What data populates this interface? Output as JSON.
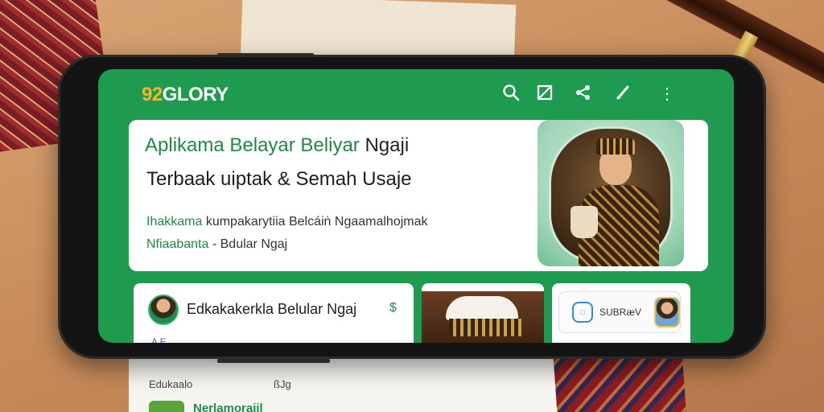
{
  "app": {
    "logo_number": "92",
    "logo_text": "GLORY"
  },
  "toolbar": {
    "icons": [
      "search-icon",
      "crop-icon",
      "share-icon",
      "edit-icon",
      "more-icon"
    ]
  },
  "hero": {
    "title_green": "Aplikama Belayar Beliyar",
    "title_dark": "Ngaji",
    "subtitle": "Terbaak uiptak & Semah Usaje",
    "line1_green": "Ihakkama",
    "line1_rest": "kumpakarytiia Belcáiṅ Ngaamalhojmak",
    "line2_green": "Nfiaabanta",
    "line2_rest": "- Bdular Ngaj"
  },
  "cards": {
    "card1_title": "Edkakakerkla Belular Ngaj",
    "card1_peek": "A   E",
    "card3_text": "SUBRæV"
  },
  "paper": {
    "label1": "Edukaalo",
    "label2": "ßJg",
    "link_text": "Nerlamorajil"
  },
  "colors": {
    "brand_green": "#1f9b4f",
    "accent_orange": "#f4b52b"
  }
}
